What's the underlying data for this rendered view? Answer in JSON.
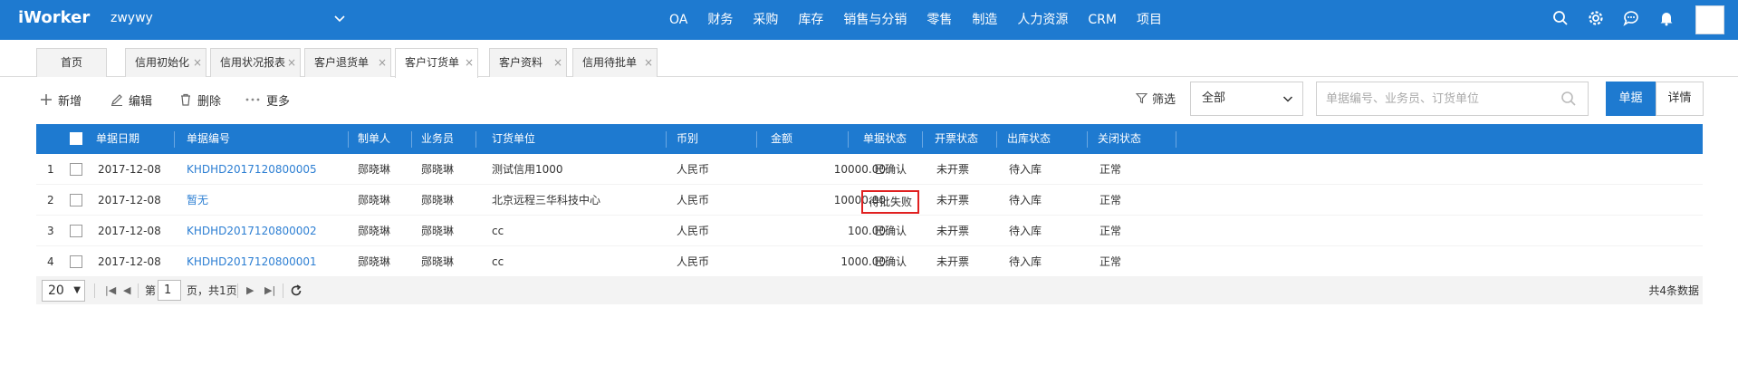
{
  "header": {
    "logo": "iWorker",
    "company": "zwywy",
    "nav": [
      "OA",
      "财务",
      "采购",
      "库存",
      "销售与分销",
      "零售",
      "制造",
      "人力资源",
      "CRM",
      "项目"
    ],
    "icons": [
      "search-icon",
      "settings-icon",
      "chat-icon",
      "bell-icon",
      "avatar"
    ]
  },
  "tabs": [
    {
      "label": "首页",
      "closable": false
    },
    {
      "label": "信用初始化",
      "closable": true
    },
    {
      "label": "信用状况报表",
      "closable": true
    },
    {
      "label": "客户退货单",
      "closable": true
    },
    {
      "label": "客户订货单",
      "closable": true,
      "active": true
    },
    {
      "label": "客户资料",
      "closable": true
    },
    {
      "label": "信用待批单",
      "closable": true
    }
  ],
  "toolbar": {
    "add": "新增",
    "edit": "编辑",
    "delete": "删除",
    "more": "更多",
    "filter": "筛选",
    "filter_value": "全部",
    "search_placeholder": "单据编号、业务员、订货单位",
    "view_bill": "单据",
    "view_detail": "详情"
  },
  "table": {
    "columns": [
      "单据日期",
      "单据编号",
      "制单人",
      "业务员",
      "订货单位",
      "币别",
      "金额",
      "单据状态",
      "开票状态",
      "出库状态",
      "关闭状态"
    ],
    "rows": [
      {
        "no": "1",
        "date": "2017-12-08",
        "code": "KHDHD2017120800005",
        "maker": "郧晓琳",
        "sales": "郧晓琳",
        "unit": "测试信用1000",
        "currency": "人民币",
        "amount": "10000.00",
        "status": "已确认",
        "invoice": "未开票",
        "outbound": "待入库",
        "close": "正常"
      },
      {
        "no": "2",
        "date": "2017-12-08",
        "code": "暂无",
        "maker": "郧晓琳",
        "sales": "郧晓琳",
        "unit": "北京远程三华科技中心",
        "currency": "人民币",
        "amount": "10000.00",
        "status": "待批失败",
        "invoice": "未开票",
        "outbound": "待入库",
        "close": "正常"
      },
      {
        "no": "3",
        "date": "2017-12-08",
        "code": "KHDHD2017120800002",
        "maker": "郧晓琳",
        "sales": "郧晓琳",
        "unit": "cc",
        "currency": "人民币",
        "amount": "100.00",
        "status": "已确认",
        "invoice": "未开票",
        "outbound": "待入库",
        "close": "正常"
      },
      {
        "no": "4",
        "date": "2017-12-08",
        "code": "KHDHD2017120800001",
        "maker": "郧晓琳",
        "sales": "郧晓琳",
        "unit": "cc",
        "currency": "人民币",
        "amount": "1000.00",
        "status": "已确认",
        "invoice": "未开票",
        "outbound": "待入库",
        "close": "正常"
      }
    ]
  },
  "pager": {
    "page_size": "20",
    "page_prefix": "第",
    "page_number": "1",
    "page_suffix": "页，共1页",
    "total": "共4条数据"
  },
  "colors": {
    "primary": "#1e7ad0",
    "link": "#2d7fd3",
    "highlight_border": "#e02020"
  }
}
